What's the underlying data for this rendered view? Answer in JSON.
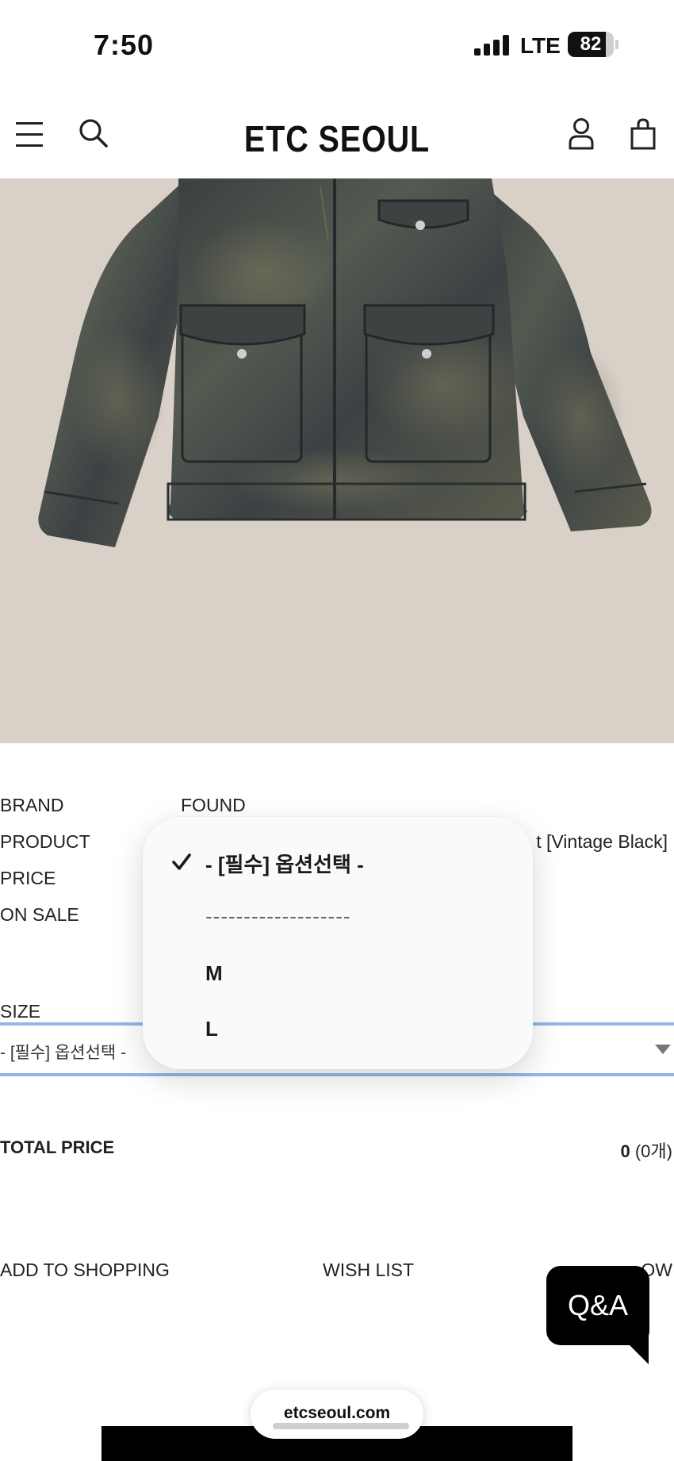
{
  "status_bar": {
    "time": "7:50",
    "network": "LTE",
    "battery": "82",
    "battery_level": 0.82
  },
  "header": {
    "brand_title": "ETC SEOUL",
    "icons": [
      "menu-icon",
      "search-icon",
      "user-icon",
      "shopping-bag-icon"
    ]
  },
  "product_info": {
    "brand_label": "BRAND",
    "brand_value": "FOUND",
    "product_label": "PRODUCT",
    "product_value_visible": "t [Vintage Black]",
    "price_label": "PRICE",
    "on_sale_label": "ON SALE"
  },
  "size": {
    "label": "SIZE",
    "selected": "- [필수] 옵션선택 -"
  },
  "total": {
    "label": "TOTAL PRICE",
    "value": "0",
    "count": "(0개)"
  },
  "actions": {
    "add_to_shopping": "ADD TO SHOPPING",
    "wish_list": "WISH LIST",
    "buy_now_partial": "OW"
  },
  "qa_button": {
    "label": "Q&A"
  },
  "dropdown": {
    "options": [
      {
        "label": "- [필수] 옵션선택 -",
        "selected": true
      },
      {
        "label": "-------------------",
        "selected": false
      },
      {
        "label": "M",
        "selected": false
      },
      {
        "label": "L",
        "selected": false
      }
    ]
  },
  "browser": {
    "url": "etcseoul.com"
  },
  "colors": {
    "image_background": "#d9d0c8",
    "select_border": "#8fb8e6",
    "qa_background": "#000000"
  }
}
